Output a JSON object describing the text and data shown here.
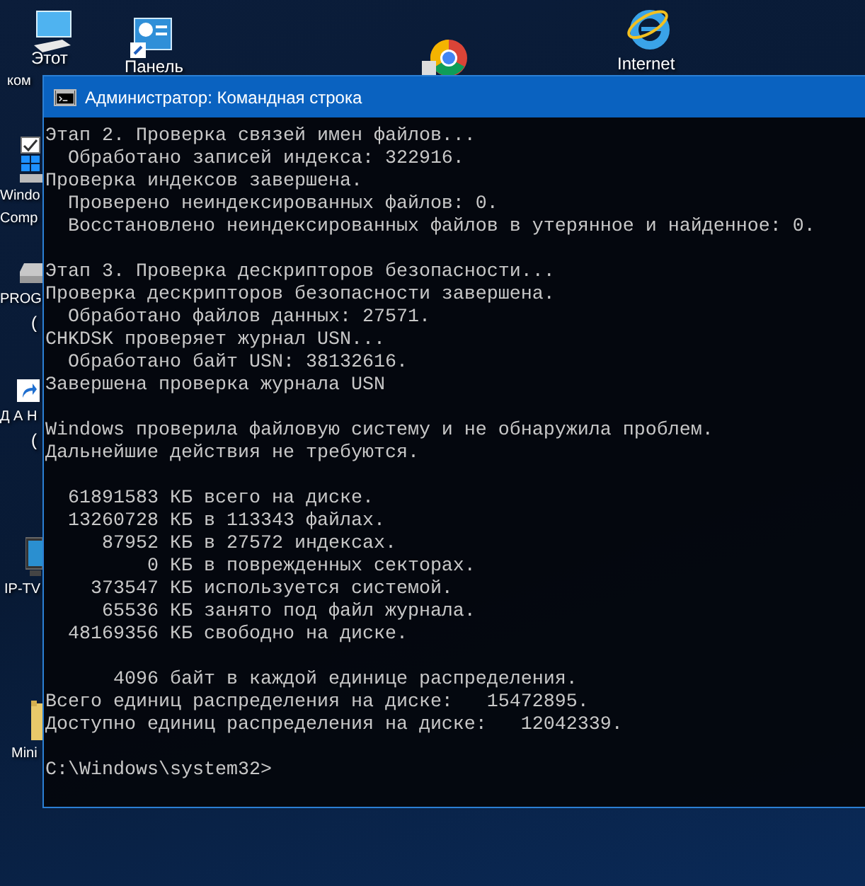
{
  "desktop_icons": [
    {
      "kind": "computer",
      "label_lines": [
        "Этот",
        "ком"
      ]
    },
    {
      "kind": "control-panel",
      "label_lines": [
        "Панель"
      ]
    },
    {
      "kind": "chrome"
    },
    {
      "kind": "ie",
      "label_lines": [
        "Internet"
      ]
    },
    {
      "kind": "drive-windows",
      "label_lines": [
        "Windo",
        "Comp"
      ]
    },
    {
      "kind": "drive",
      "label_lines": [
        "PROG",
        "("
      ]
    },
    {
      "kind": "shortcut",
      "label_lines": [
        "Д А Н",
        "("
      ]
    },
    {
      "kind": "tv",
      "label_lines": [
        "IP-TV"
      ]
    },
    {
      "kind": "folder",
      "label_lines": [
        "Mini"
      ]
    }
  ],
  "window": {
    "title": "Администратор: Командная строка",
    "active": true
  },
  "console_blocks": [
    [
      "Этап 2. Проверка связей имен файлов...",
      "  Обработано записей индекса: 322916.",
      "Проверка индексов завершена.",
      "  Проверено неиндексированных файлов: 0.",
      "  Восстановлено неиндексированных файлов в утерянное и найденное: 0."
    ],
    [
      "Этап 3. Проверка дескрипторов безопасности...",
      "Проверка дескрипторов безопасности завершена.",
      "  Обработано файлов данных: 27571.",
      "CHKDSK проверяет журнал USN...",
      "  Обработано байт USN: 38132616.",
      "Завершена проверка журнала USN"
    ],
    [
      "Windows проверила файловую систему и не обнаружила проблем.",
      "Дальнейшие действия не требуются."
    ],
    [
      "  61891583 КБ всего на диске.",
      "  13260728 КБ в 113343 файлах.",
      "     87952 КБ в 27572 индексах.",
      "         0 КБ в поврежденных секторах.",
      "    373547 КБ используется системой.",
      "     65536 КБ занято под файл журнала.",
      "  48169356 КБ свободно на диске."
    ],
    [
      "      4096 байт в каждой единице распределения.",
      "Всего единиц распределения на диске:   15472895.",
      "Доступно единиц распределения на диске:   12042339."
    ],
    [
      "C:\\Windows\\system32>"
    ]
  ]
}
